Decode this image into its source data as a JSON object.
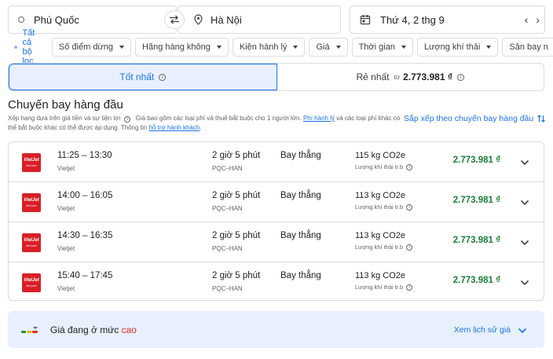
{
  "search": {
    "origin": "Phú Quốc",
    "destination": "Hà Nội",
    "date": "Thứ 4, 2 thg 9"
  },
  "filters": {
    "all_filters_label": "Tất cả bộ lọc",
    "chips": [
      "Số điểm dừng",
      "Hãng hàng không",
      "Kiện hành lý",
      "Giá",
      "Thời gian",
      "Lượng khí thải",
      "Sân bay n"
    ]
  },
  "tabs": {
    "best_label": "Tốt nhất",
    "cheapest_label": "Rẻ nhất",
    "cheapest_from": "từ",
    "cheapest_price": "2.773.981 ₫"
  },
  "section": {
    "title": "Chuyến bay hàng đầu",
    "subtitle_part1": "Xếp hạng dựa trên giá tiền và sự tiện lợi",
    "subtitle_part2": "Giá bao gồm các loại phí và thuế bắt buộc cho 1 người lớn.",
    "baggage_link": "Phí hành lý",
    "subtitle_part3": "và các loại phí khác có thể bắt buộc khác có thể được áp dụng. Thông tin",
    "assistance_link": "hỗ trợ hành khách",
    "sort_label": "Sắp xếp theo chuyến bay hàng đầu"
  },
  "flights": [
    {
      "times": "11:25 – 13:30",
      "airline": "Vietjet",
      "duration": "2 giờ 5 phút",
      "route": "PQC–HAN",
      "stops": "Bay thẳng",
      "co2": "115 kg CO2e",
      "co2_label": "Lượng khí thải tr.b",
      "price": "2.773.981 ₫"
    },
    {
      "times": "14:00 – 16:05",
      "airline": "Vietjet",
      "duration": "2 giờ 5 phút",
      "route": "PQC–HAN",
      "stops": "Bay thẳng",
      "co2": "113 kg CO2e",
      "co2_label": "Lượng khí thải tr.b",
      "price": "2.773.981 ₫"
    },
    {
      "times": "14:30 – 16:35",
      "airline": "Vietjet",
      "duration": "2 giờ 5 phút",
      "route": "PQC–HAN",
      "stops": "Bay thẳng",
      "co2": "113 kg CO2e",
      "co2_label": "Lượng khí thải tr.b",
      "price": "2.773.981 ₫"
    },
    {
      "times": "15:40 – 17:45",
      "airline": "Vietjet",
      "duration": "2 giờ 5 phút",
      "route": "PQC–HAN",
      "stops": "Bay thẳng",
      "co2": "113 kg CO2e",
      "co2_label": "Lượng khí thải tr.b",
      "price": "2.773.981 ₫"
    }
  ],
  "airline_logo": {
    "line1": "VietJet",
    "line2": "Air.com",
    "color": "#d91f26"
  },
  "insight": {
    "text": "Giá đang ở mức",
    "level": "cao",
    "history_link": "Xem lịch sử giá"
  },
  "colors": {
    "accent": "#1a73e8",
    "price_green": "#188038",
    "high_red": "#d93025"
  }
}
